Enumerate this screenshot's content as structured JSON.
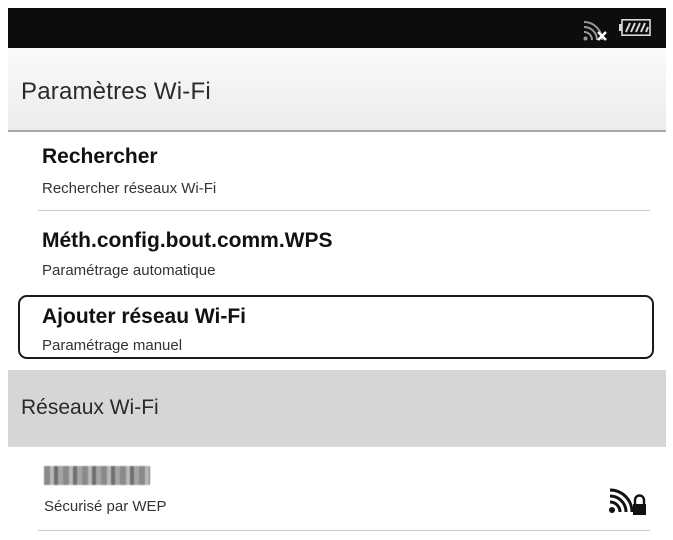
{
  "status_bar": {
    "wifi_icon": "wifi-disconnected-icon",
    "battery_icon": "battery-icon",
    "battery_level": 1.0
  },
  "header": {
    "title": "Paramètres Wi-Fi"
  },
  "menu": {
    "items": [
      {
        "title": "Rechercher",
        "subtitle": "Rechercher réseaux Wi-Fi"
      },
      {
        "title": "Méth.config.bout.comm.WPS",
        "subtitle": "Paramétrage automatique"
      },
      {
        "title": "Ajouter réseau Wi-Fi",
        "subtitle": "Paramétrage manuel",
        "selected": true
      }
    ]
  },
  "networks_section": {
    "title": "Réseaux Wi-Fi",
    "networks": [
      {
        "ssid": "",
        "ssid_obscured": true,
        "security": "Sécurisé par WEP",
        "icon": "wifi-locked-icon"
      }
    ]
  },
  "colors": {
    "status_bar": "#0d0d0d",
    "section_header": "#d6d6d6",
    "selection_border": "#1a1a1a"
  }
}
